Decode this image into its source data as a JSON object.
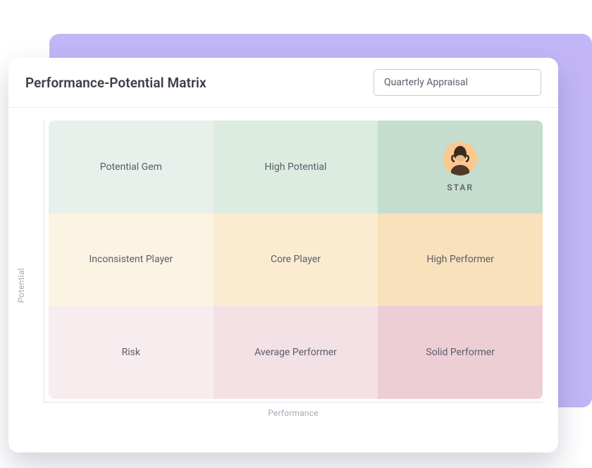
{
  "header": {
    "title": "Performance-Potential Matrix",
    "selector_value": "Quarterly Appraisal"
  },
  "axes": {
    "y": "Potential",
    "x": "Performance"
  },
  "matrix": {
    "r1c1": "Potential Gem",
    "r1c2": "High Potential",
    "r1c3": "STAR",
    "r2c1": "Inconsistent Player",
    "r2c2": "Core Player",
    "r2c3": "High Performer",
    "r3c1": "Risk",
    "r3c2": "Average Performer",
    "r3c3": "Solid Performer"
  }
}
